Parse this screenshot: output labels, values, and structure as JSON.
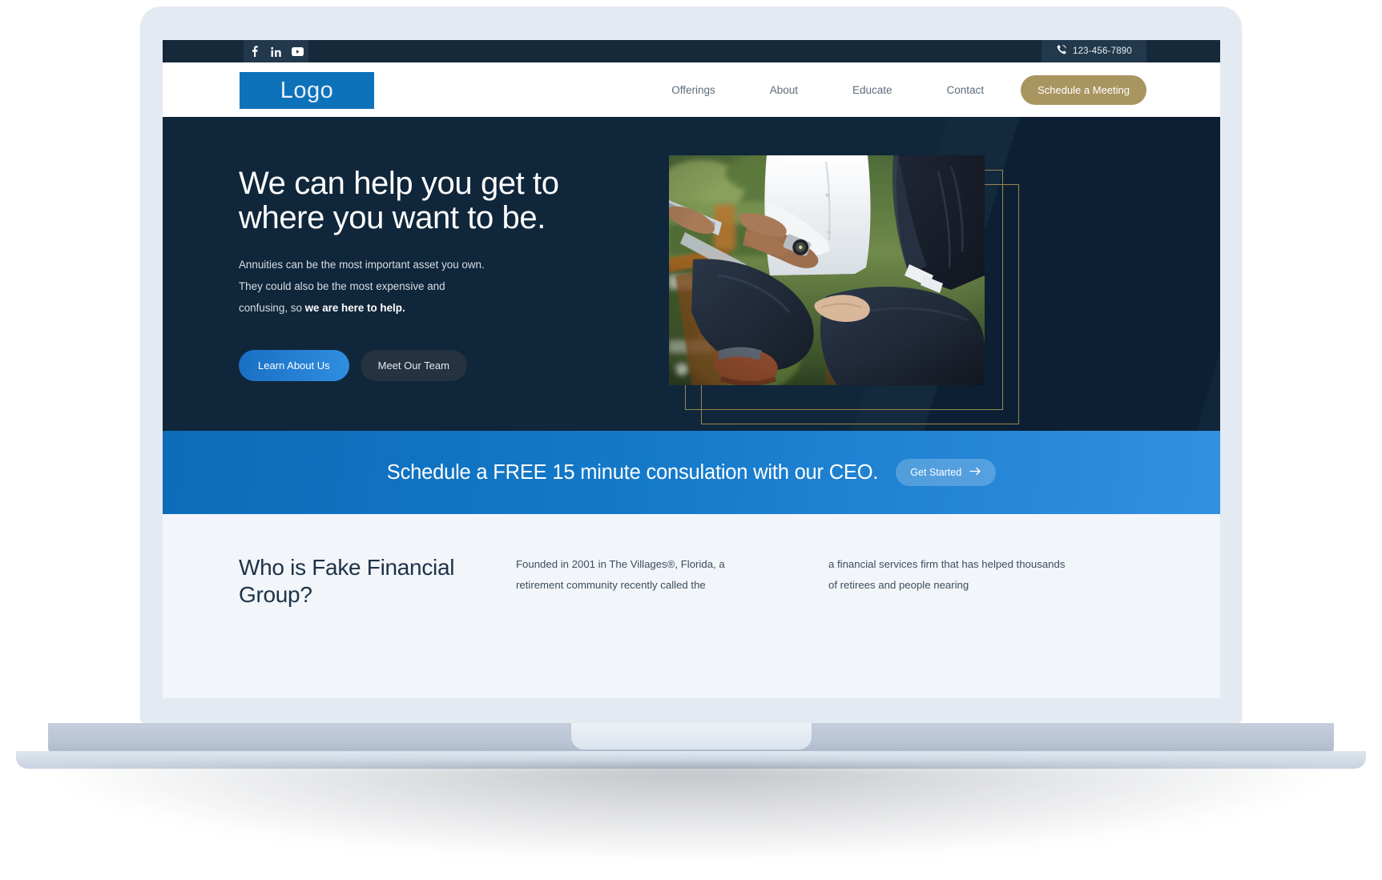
{
  "topbar": {
    "social": [
      {
        "name": "facebook-icon",
        "label": "f"
      },
      {
        "name": "linkedin-icon",
        "label": "in"
      },
      {
        "name": "youtube-icon",
        "label": "▶"
      }
    ],
    "phone": "123-456-7890",
    "phone_icon": "phone-icon"
  },
  "nav": {
    "logo": "Logo",
    "links": [
      {
        "label": "Offerings"
      },
      {
        "label": "About"
      },
      {
        "label": "Educate"
      },
      {
        "label": "Contact"
      }
    ],
    "cta": "Schedule a Meeting"
  },
  "hero": {
    "title": "We can help you get to where you want to be.",
    "sub_plain": "Annuities can be the most important asset you own. They could also be the most expensive and confusing, so ",
    "sub_bold": "we are here to help.",
    "btn_primary": "Learn About Us",
    "btn_secondary": "Meet Our Team",
    "image_alt": "two-businessmen-seated-outdoors-with-tablet"
  },
  "band": {
    "text": "Schedule a FREE 15 minute consulation with our CEO.",
    "button": "Get Started",
    "button_icon": "arrow-right-icon"
  },
  "who": {
    "title": "Who is Fake Financial Group?",
    "col1": "Founded in 2001 in The Villages®, Florida, a retirement community recently called the",
    "col2": "a financial services firm that has helped thousands of retirees and people nearing"
  },
  "colors": {
    "topbar_bg": "#16293b",
    "logo_blue": "#0d72b9",
    "nav_gold": "#a99560",
    "hero_bg": "#10263a",
    "band_blue": "#1479c9",
    "section_bg": "#f2f5f9",
    "frame_gold": "#97874f"
  }
}
